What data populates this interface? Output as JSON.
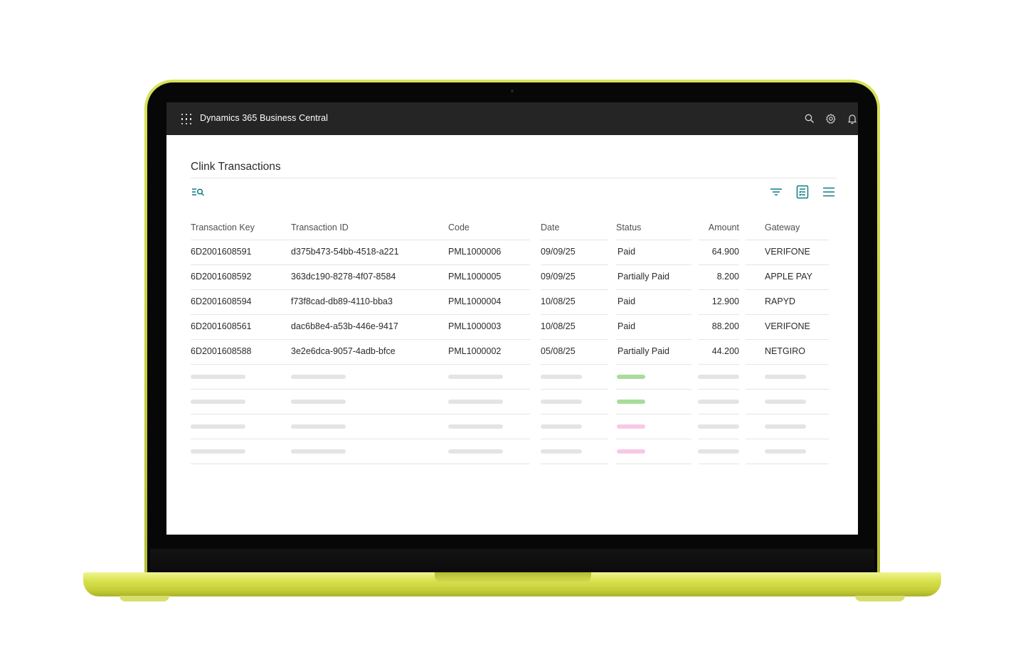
{
  "app": {
    "title": "Dynamics 365 Business Central"
  },
  "topbar_icons": [
    "waffle-icon",
    "search-icon",
    "gear-icon",
    "bell-icon"
  ],
  "page": {
    "title": "Clink Transactions",
    "actions": [
      "search-list-icon",
      "filter-icon",
      "document-icon",
      "menu-icon"
    ]
  },
  "colors": {
    "accent": "#0f7b84",
    "topbar": "#252525",
    "laptop": "#d1da48",
    "status_paid": "#a8dc9a",
    "status_partial": "#f7c9e6"
  },
  "table": {
    "columns": [
      "Transaction Key",
      "Transaction ID",
      "Code",
      "Date",
      "Status",
      "Amount",
      "Gateway"
    ],
    "rows": [
      [
        "6D2001608591",
        "d375b473-54bb-4518-a221",
        "PML1000006",
        "09/09/25",
        "Paid",
        "64.900",
        "VERIFONE"
      ],
      [
        "6D2001608592",
        "363dc190-8278-4f07-8584",
        "PML1000005",
        "09/09/25",
        "Partially Paid",
        "8.200",
        "APPLE PAY"
      ],
      [
        "6D2001608594",
        "f73f8cad-db89-4110-bba3",
        "PML1000004",
        "10/08/25",
        "Paid",
        "12.900",
        "RAPYD"
      ],
      [
        "6D2001608561",
        "dac6b8e4-a53b-446e-9417",
        "PML1000003",
        "10/08/25",
        "Paid",
        "88.200",
        "VERIFONE"
      ],
      [
        "6D2001608588",
        "3e2e6dca-9057-4adb-bfce",
        "PML1000002",
        "05/08/25",
        "Partially Paid",
        "44.200",
        "NETGIRO"
      ]
    ],
    "placeholder_rows": [
      {
        "status_color": "green"
      },
      {
        "status_color": "green"
      },
      {
        "status_color": "pink"
      },
      {
        "status_color": "pink"
      }
    ]
  }
}
